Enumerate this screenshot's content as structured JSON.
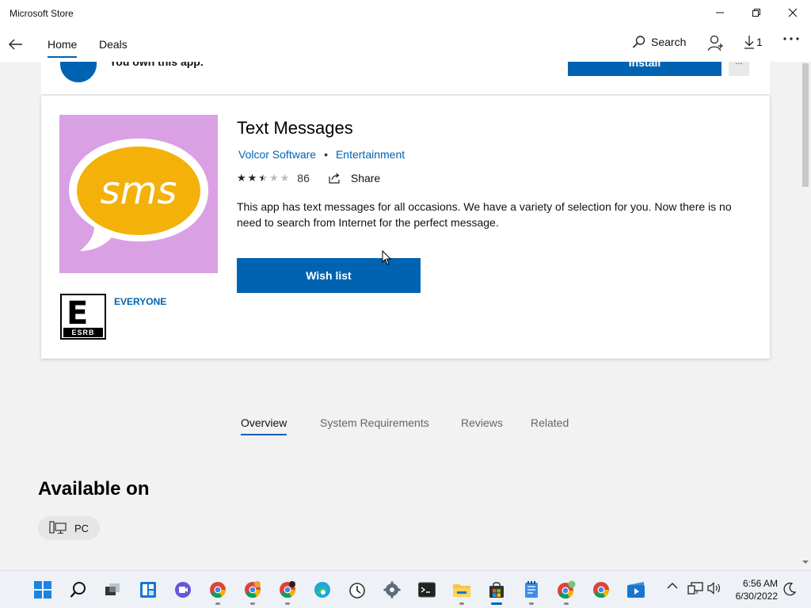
{
  "window": {
    "title": "Microsoft Store"
  },
  "nav": {
    "tabs": [
      {
        "label": "Home",
        "active": true
      },
      {
        "label": "Deals",
        "active": false
      }
    ],
    "search_label": "Search",
    "downloads_count": "1"
  },
  "top_card": {
    "owned_text": "You own this app.",
    "install_label": "Install",
    "more_label": "..."
  },
  "app": {
    "name": "Text Messages",
    "icon_text": "sms",
    "publisher": "Volcor Software",
    "category": "Entertainment",
    "rating_stars": 2.5,
    "rating_max": 5,
    "rating_count": "86",
    "share_label": "Share",
    "description": "This app has text messages for all occasions. We have a variety of selection for you. Now there is no need to search from Internet for the perfect message.",
    "wish_list_label": "Wish list",
    "esrb_letter": "E",
    "esrb_brand": "ESRB",
    "age_rating": "EVERYONE"
  },
  "pivots": [
    {
      "label": "Overview",
      "active": true
    },
    {
      "label": "System Requirements",
      "active": false
    },
    {
      "label": "Reviews",
      "active": false
    },
    {
      "label": "Related",
      "active": false
    }
  ],
  "available_on": {
    "title": "Available on",
    "platforms": [
      "PC"
    ]
  },
  "taskbar": {
    "time": "6:56 AM",
    "date": "6/30/2022"
  },
  "colors": {
    "accent": "#0063b1",
    "icon_bg": "#d9a1e4",
    "bubble": "#f3b10a"
  }
}
